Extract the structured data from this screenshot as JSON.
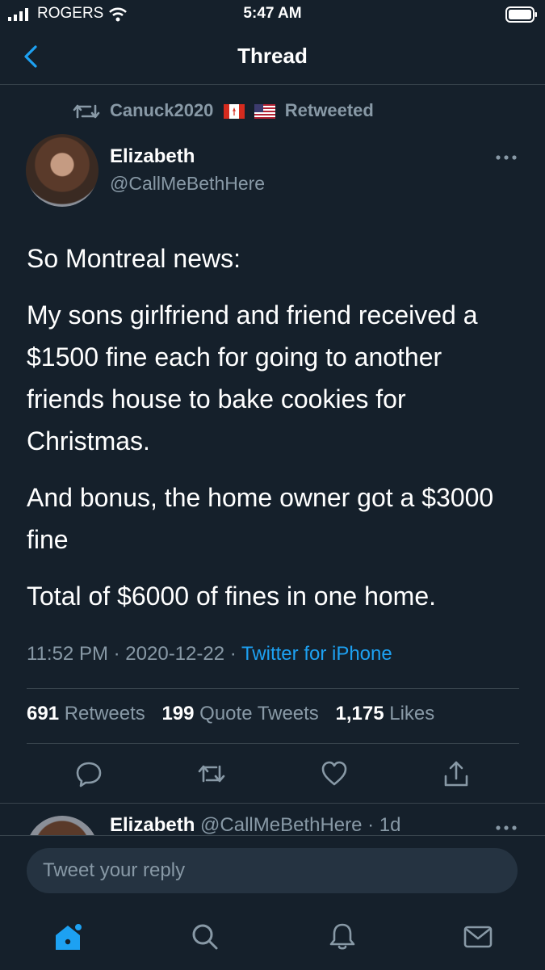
{
  "status_bar": {
    "carrier": "ROGERS",
    "time": "5:47 AM"
  },
  "nav": {
    "title": "Thread",
    "back_icon": "chevron-left-icon"
  },
  "retweet": {
    "label": "Canuck2020",
    "suffix": "Retweeted",
    "flags": [
      "canada-flag",
      "usa-flag"
    ]
  },
  "author": {
    "name": "Elizabeth",
    "handle": "@CallMeBethHere"
  },
  "tweet": {
    "paragraphs": [
      "So Montreal news:",
      "My sons girlfriend and friend received a $1500 fine each for going to another friends house to bake cookies for Christmas.",
      "And bonus, the home owner got a $3000 fine",
      "Total of $6000 of fines in one home."
    ],
    "time": "11:52 PM",
    "date": "2020-12-22",
    "source": "Twitter for iPhone"
  },
  "stats": {
    "retweets_count": "691",
    "retweets_label": "Retweets",
    "quotes_count": "199",
    "quotes_label": "Quote Tweets",
    "likes_count": "1,175",
    "likes_label": "Likes"
  },
  "reply_preview": {
    "name": "Elizabeth",
    "handle": "@CallMeBethHere",
    "age": "1d"
  },
  "composer": {
    "placeholder": "Tweet your reply"
  },
  "colors": {
    "background": "#15202b",
    "accent": "#1da1f2",
    "muted": "#8899a6",
    "divider": "#38444d"
  }
}
